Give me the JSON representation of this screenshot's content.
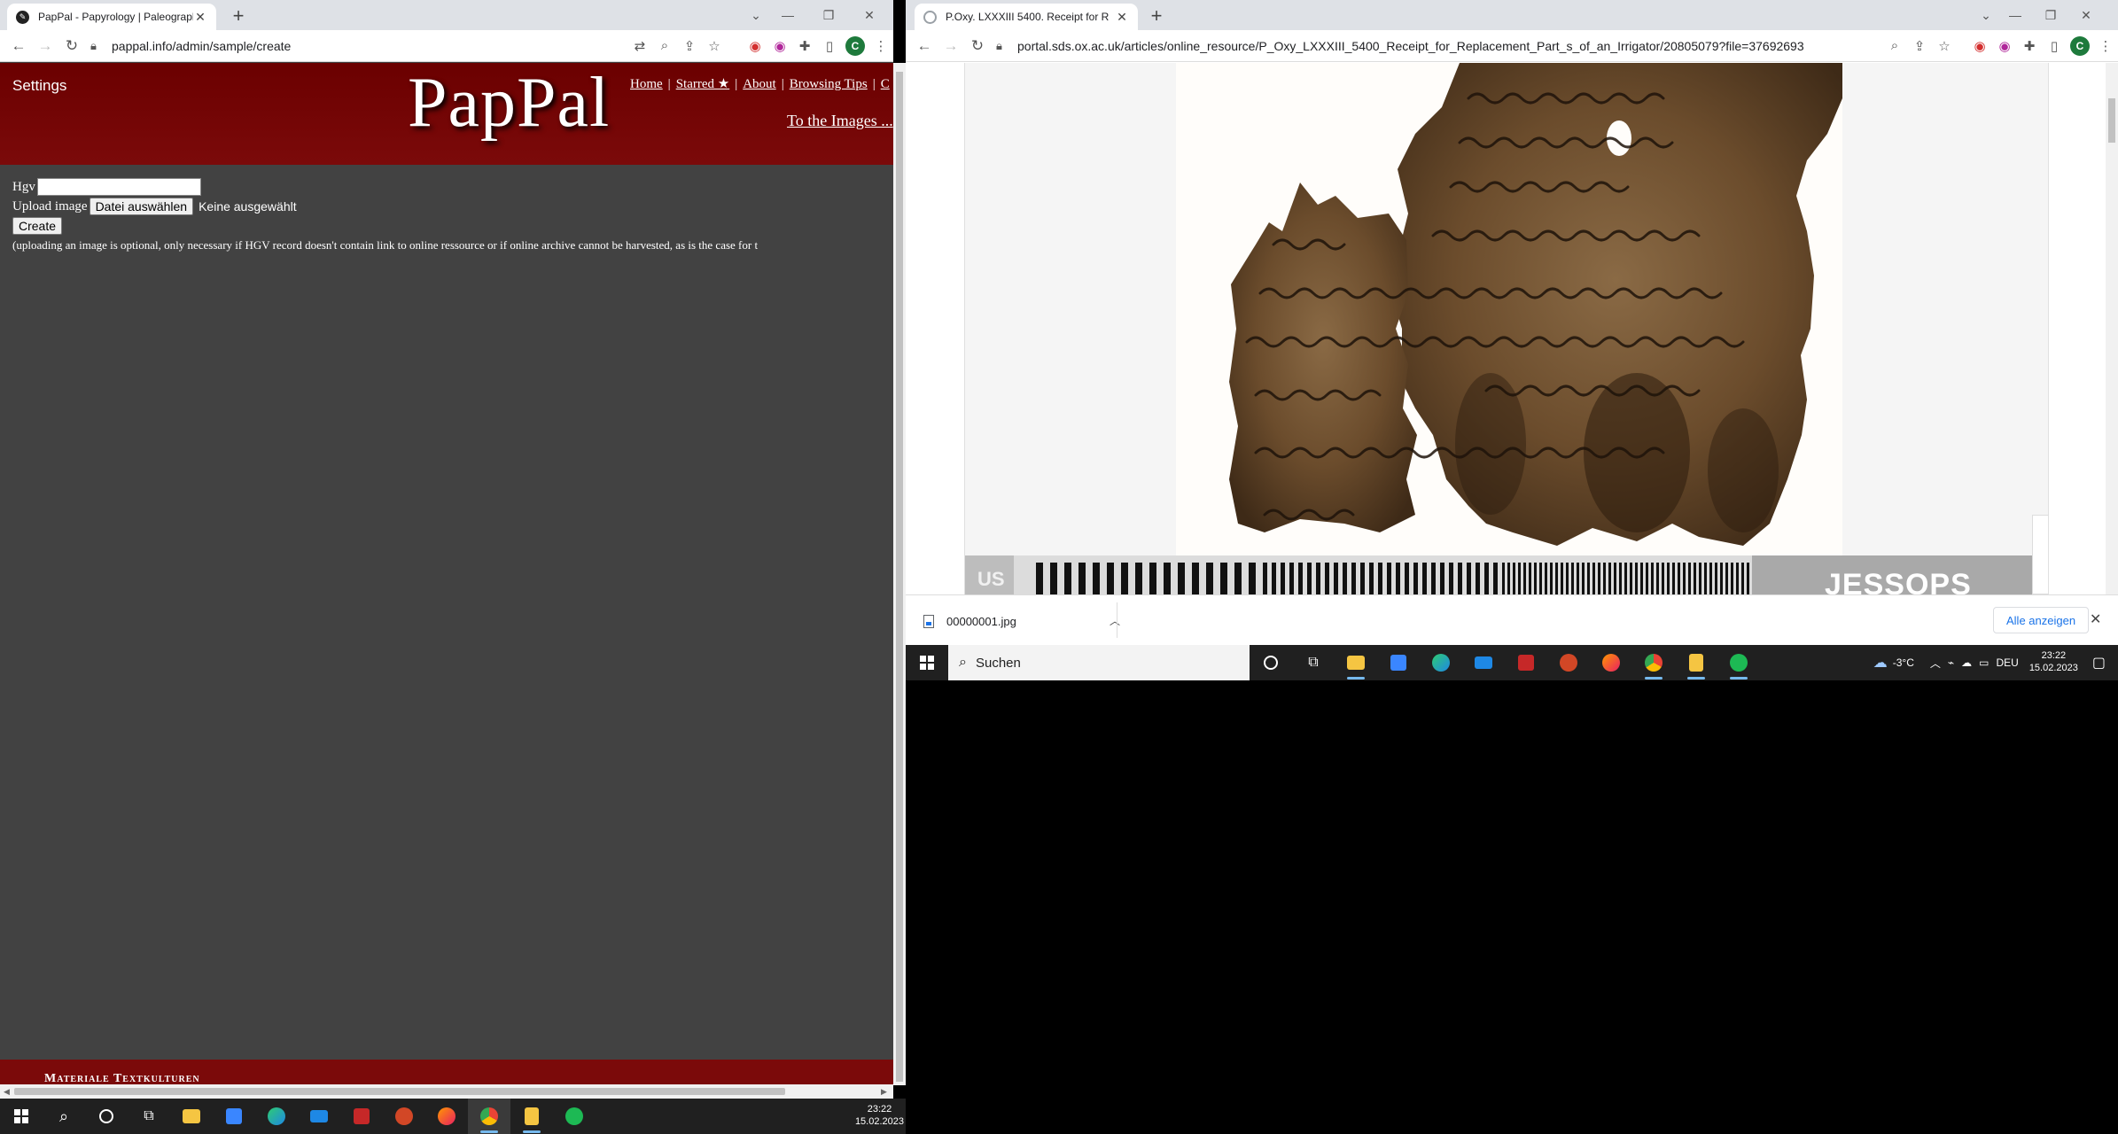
{
  "left_window": {
    "tab_title": "PapPal - Papyrology | Paleograph",
    "url": "pappal.info/admin/sample/create",
    "site": {
      "settings": "Settings",
      "logo": "PapPal",
      "nav": [
        "Home",
        "Starred ★",
        "About",
        "Browsing Tips",
        "C"
      ],
      "to_images": "To the Images ..."
    },
    "form": {
      "hgv_label": "Hgv",
      "upload_label": "Upload image",
      "file_button": "Datei auswählen",
      "file_status": "Keine ausgewählt",
      "create_button": "Create",
      "note": "(uploading an image is optional, only necessary if HGV record doesn't contain link to online ressource or if online archive cannot be harvested, as is the case for t"
    },
    "footer": "Materiale Textkulturen"
  },
  "right_window": {
    "tab_title": "P.Oxy. LXXXIII 5400. Receipt for R",
    "url": "portal.sds.ox.ac.uk/articles/online_resource/P_Oxy_LXXXIII_5400_Receipt_for_Replacement_Part_s_of_an_Irrigator/20805079?file=37692693",
    "image": {
      "scale_brand": "JESSOPS",
      "scale_left_text": "US"
    },
    "downloads": {
      "file": "00000001.jpg",
      "show_all": "Alle anzeigen"
    }
  },
  "taskbar_small": {
    "search": "Suchen",
    "weather": "-3°C",
    "lang": "DEU",
    "time": "23:22",
    "date": "15.02.2023"
  },
  "taskbar_big": {
    "time": "23:22",
    "date": "15.02.2023"
  },
  "colors": {
    "pappal_red": "#6b0000",
    "page_gray": "#424242",
    "taskbar": "#202020",
    "link_blue": "#1a73e8"
  }
}
